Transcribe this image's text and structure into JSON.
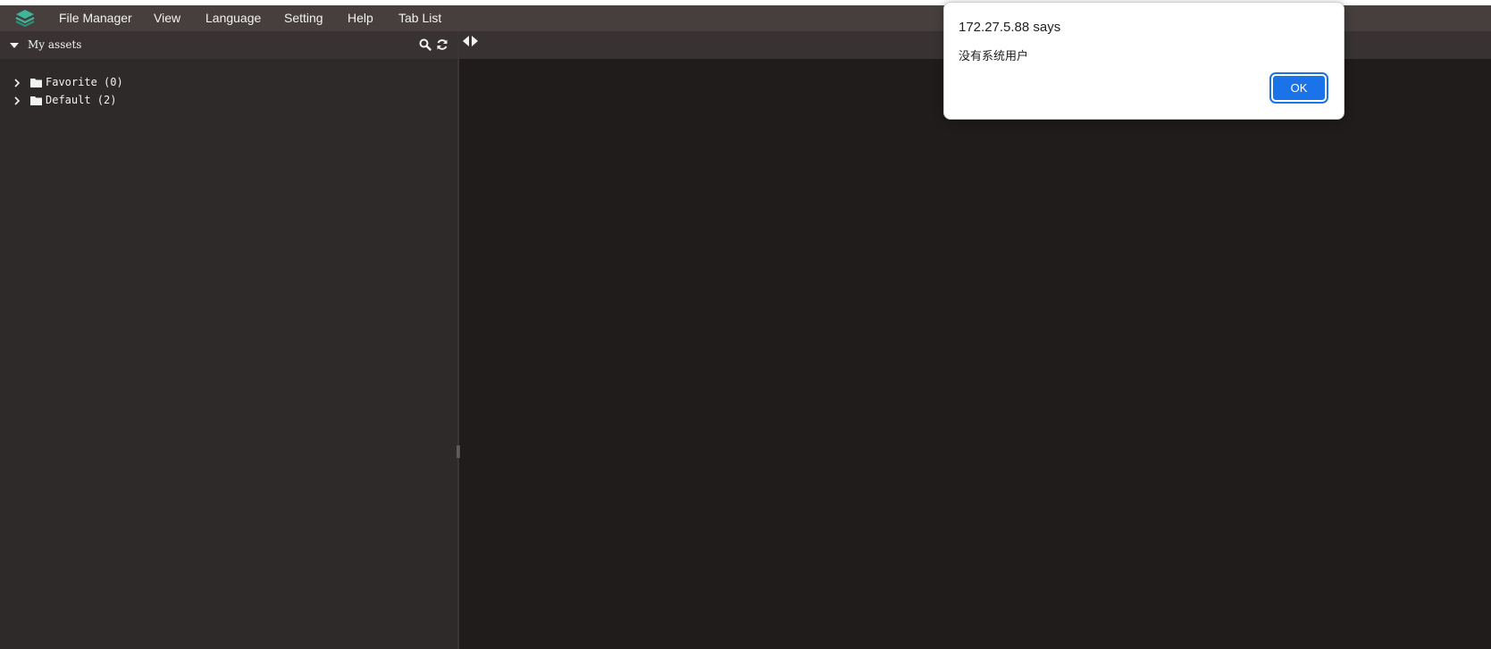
{
  "menubar": {
    "logo_icon": "layers-logo-icon",
    "items": [
      "File Manager",
      "View",
      "Language",
      "Setting",
      "Help",
      "Tab List"
    ]
  },
  "sidebar": {
    "title": "My assets",
    "icons": [
      "search-icon",
      "refresh-icon"
    ],
    "tree": [
      {
        "label": "Favorite (0)",
        "icon": "folder-icon"
      },
      {
        "label": "Default (2)",
        "icon": "folder-icon"
      }
    ]
  },
  "main": {
    "tab_scroll_icons": [
      "arrow-left-icon",
      "arrow-right-icon"
    ]
  },
  "dialog": {
    "title": "172.27.5.88 says",
    "message": "没有系统用户",
    "ok_label": "OK"
  },
  "colors": {
    "menubar_bg": "#463f3e",
    "sidebar_bg": "#2e2a29",
    "main_bg": "#1f1c1b",
    "accent": "#1a73e8",
    "logo": "#3fb59a"
  }
}
